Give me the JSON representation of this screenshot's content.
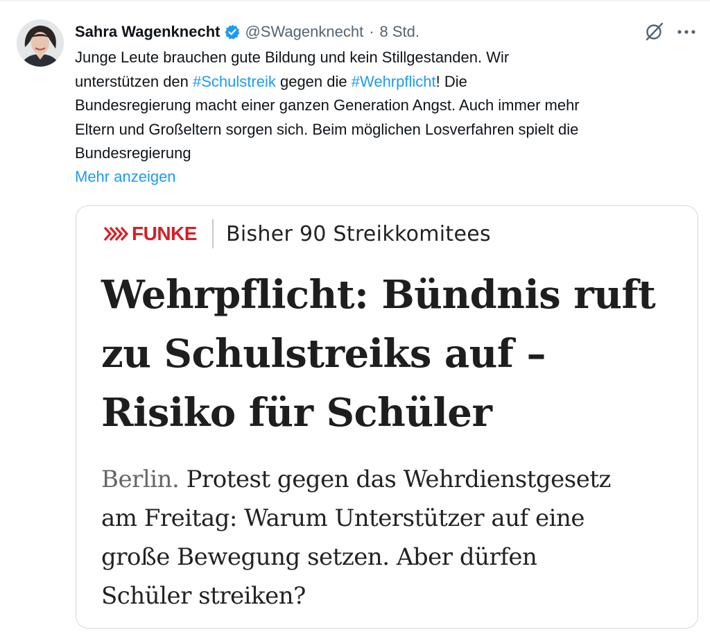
{
  "tweet": {
    "author_name": "Sahra Wagenknecht",
    "verified": true,
    "handle": "@SWagenknecht",
    "separator": "·",
    "time": "8 Std.",
    "text_lines": [
      "Junge Leute brauchen gute Bildung und kein Stillgestanden. Wir",
      [
        "unterstützen den ",
        "#Schulstreik",
        " gegen die ",
        "#Wehrpflicht",
        "! Die"
      ],
      "Bundesregierung macht einer ganzen Generation Angst. Auch immer mehr",
      "Eltern und Großeltern sorgen sich. Beim möglichen Losverfahren spielt die",
      "Bundesregierung"
    ],
    "show_more_label": "Mehr anzeigen",
    "icons": [
      "verified-badge-icon",
      "grok-icon",
      "more-options-icon"
    ],
    "colors": {
      "link": "#1d9bf0",
      "verified": "#1d9bf0",
      "secondary_text": "#536471"
    }
  },
  "card": {
    "brand": "FUNKE",
    "kicker": "Bisher 90 Streikkomitees",
    "headline_lines": [
      "Wehrpflicht: Bündnis ruft",
      "zu Schulstreiks auf –",
      "Risiko für Schüler"
    ],
    "teaser_dateline": "Berlin.",
    "teaser_lines": [
      " Protest gegen das Wehrdienstgesetz",
      "am Freitag: Warum Unterstützer auf eine",
      "große Bewegung setzen. Aber dürfen",
      "Schüler streiken?"
    ],
    "colors": {
      "brand": "#d61f26"
    }
  }
}
